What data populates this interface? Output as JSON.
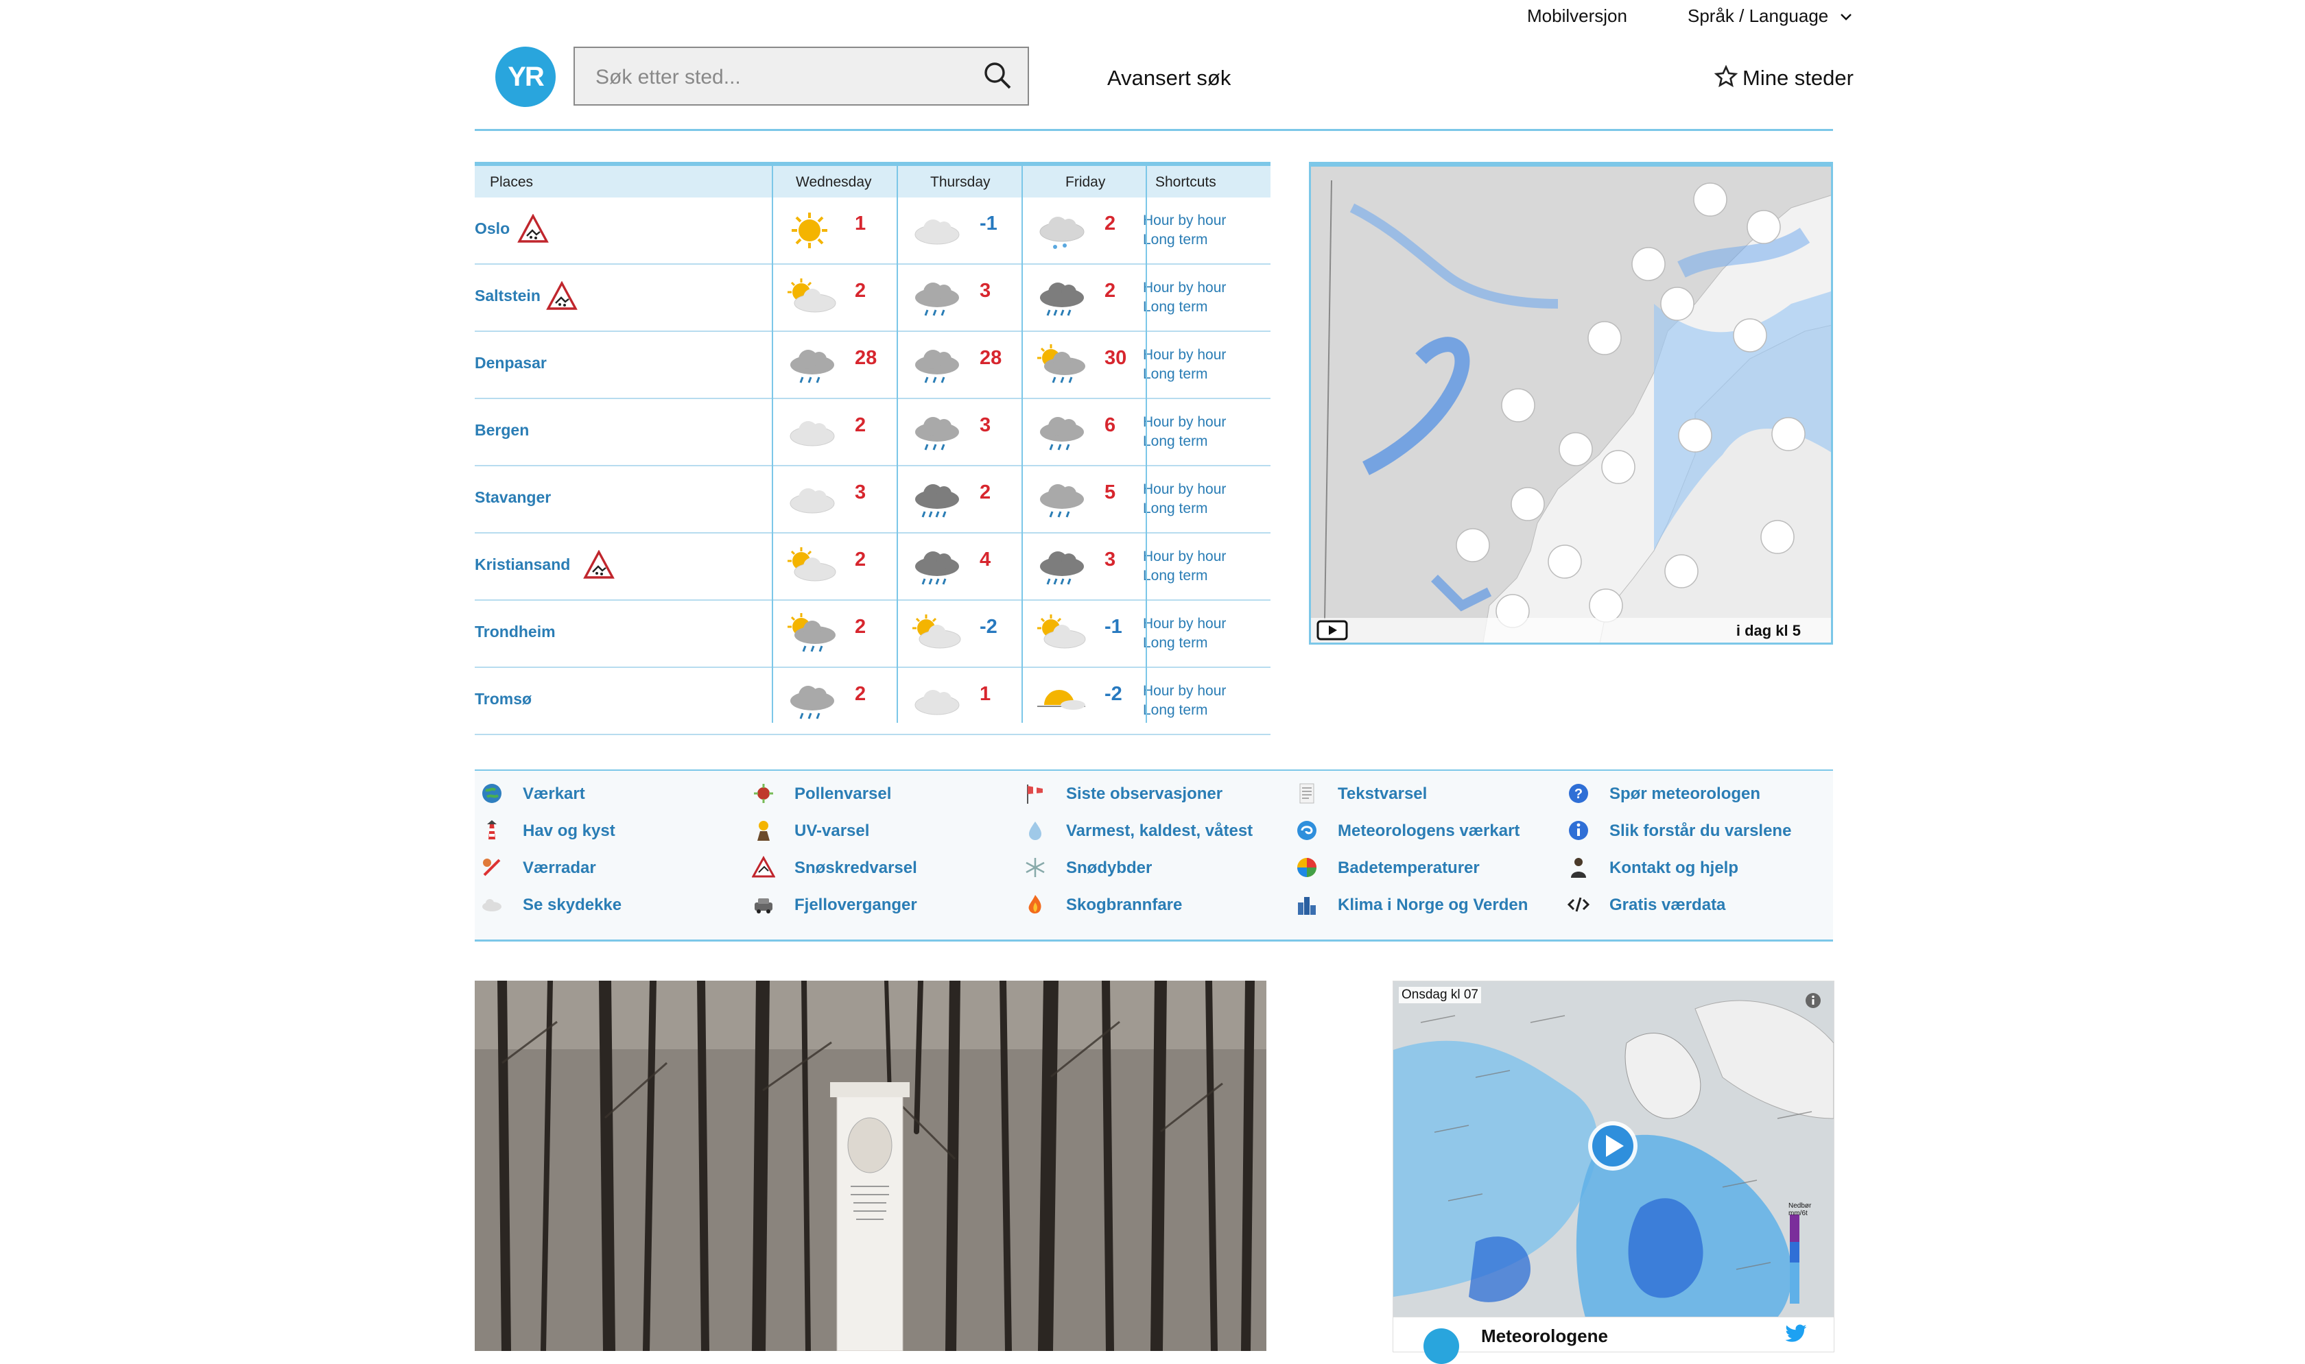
{
  "header": {
    "mobile_link": "Mobilversjon",
    "language_link": "Språk / Language",
    "logo_text": "YR",
    "search_placeholder": "Søk etter sted...",
    "advanced_search": "Avansert søk",
    "my_places": "Mine steder"
  },
  "forecast": {
    "columns": [
      "Places",
      "Wednesday",
      "Thursday",
      "Friday",
      "Shortcuts"
    ],
    "shortcut_hour": "Hour by hour",
    "shortcut_long": "Long term",
    "rows": [
      {
        "place": "Oslo",
        "warning": true,
        "days": [
          {
            "icon": "sun",
            "temp": "1",
            "warm": true
          },
          {
            "icon": "cloud",
            "temp": "-1",
            "warm": false
          },
          {
            "icon": "cloud-snow",
            "temp": "2",
            "warm": true
          }
        ]
      },
      {
        "place": "Saltstein",
        "warning": true,
        "days": [
          {
            "icon": "sun-cloud",
            "temp": "2",
            "warm": true
          },
          {
            "icon": "cloud-rain",
            "temp": "3",
            "warm": true
          },
          {
            "icon": "dark-cloud-rain",
            "temp": "2",
            "warm": true
          }
        ]
      },
      {
        "place": "Denpasar",
        "warning": false,
        "days": [
          {
            "icon": "cloud-rain",
            "temp": "28",
            "warm": true
          },
          {
            "icon": "cloud-rain",
            "temp": "28",
            "warm": true
          },
          {
            "icon": "sun-cloud-rain",
            "temp": "30",
            "warm": true
          }
        ]
      },
      {
        "place": "Bergen",
        "warning": false,
        "days": [
          {
            "icon": "cloud",
            "temp": "2",
            "warm": true
          },
          {
            "icon": "cloud-rain",
            "temp": "3",
            "warm": true
          },
          {
            "icon": "cloud-rain",
            "temp": "6",
            "warm": true
          }
        ]
      },
      {
        "place": "Stavanger",
        "warning": false,
        "days": [
          {
            "icon": "cloud",
            "temp": "3",
            "warm": true
          },
          {
            "icon": "dark-cloud-rain",
            "temp": "2",
            "warm": true
          },
          {
            "icon": "cloud-rain",
            "temp": "5",
            "warm": true
          }
        ]
      },
      {
        "place": "Kristiansand",
        "warning": true,
        "days": [
          {
            "icon": "sun-cloud",
            "temp": "2",
            "warm": true
          },
          {
            "icon": "dark-cloud-rain",
            "temp": "4",
            "warm": true
          },
          {
            "icon": "dark-cloud-rain",
            "temp": "3",
            "warm": true
          }
        ]
      },
      {
        "place": "Trondheim",
        "warning": false,
        "days": [
          {
            "icon": "sun-cloud-rain",
            "temp": "2",
            "warm": true
          },
          {
            "icon": "sun-cloud",
            "temp": "-2",
            "warm": false
          },
          {
            "icon": "sun-cloud",
            "temp": "-1",
            "warm": false
          }
        ]
      },
      {
        "place": "Tromsø",
        "warning": false,
        "days": [
          {
            "icon": "cloud-rain",
            "temp": "2",
            "warm": true
          },
          {
            "icon": "cloud",
            "temp": "1",
            "warm": true
          },
          {
            "icon": "sun-horizon",
            "temp": "-2",
            "warm": false
          }
        ]
      }
    ]
  },
  "map": {
    "time_label": "i dag kl 5"
  },
  "links": [
    [
      {
        "label": "Værkart",
        "icon": "globe-icon"
      },
      {
        "label": "Hav og kyst",
        "icon": "lighthouse-icon"
      },
      {
        "label": "Værradar",
        "icon": "radar-icon"
      },
      {
        "label": "Se skydekke",
        "icon": "cloud-icon"
      }
    ],
    [
      {
        "label": "Pollenvarsel",
        "icon": "pollen-icon"
      },
      {
        "label": "UV-varsel",
        "icon": "uv-icon"
      },
      {
        "label": "Snøskredvarsel",
        "icon": "avalanche-icon"
      },
      {
        "label": "Fjelloverganger",
        "icon": "car-icon"
      }
    ],
    [
      {
        "label": "Siste observasjoner",
        "icon": "windsock-icon"
      },
      {
        "label": "Varmest, kaldest, våtest",
        "icon": "drop-icon"
      },
      {
        "label": "Snødybder",
        "icon": "snowflake-icon"
      },
      {
        "label": "Skogbrannfare",
        "icon": "fire-icon"
      }
    ],
    [
      {
        "label": "Tekstvarsel",
        "icon": "document-icon"
      },
      {
        "label": "Meteorologens værkart",
        "icon": "swirl-icon"
      },
      {
        "label": "Badetemperaturer",
        "icon": "beachball-icon"
      },
      {
        "label": "Klima i Norge og Verden",
        "icon": "city-icon"
      }
    ],
    [
      {
        "label": "Spør meteorologen",
        "icon": "question-icon"
      },
      {
        "label": "Slik forstår du varslene",
        "icon": "info-icon"
      },
      {
        "label": "Kontakt og hjelp",
        "icon": "person-icon"
      },
      {
        "label": "Gratis værdata",
        "icon": "code-icon"
      }
    ]
  ],
  "tweet": {
    "map_time": "Onsdag kl 07",
    "account": "Meteorologene",
    "legend_title": "Nedbør mm/6t"
  },
  "colors": {
    "accent": "#29a5dd",
    "link": "#2a7db5",
    "warm": "#d7262e",
    "cold": "#2779bf"
  }
}
